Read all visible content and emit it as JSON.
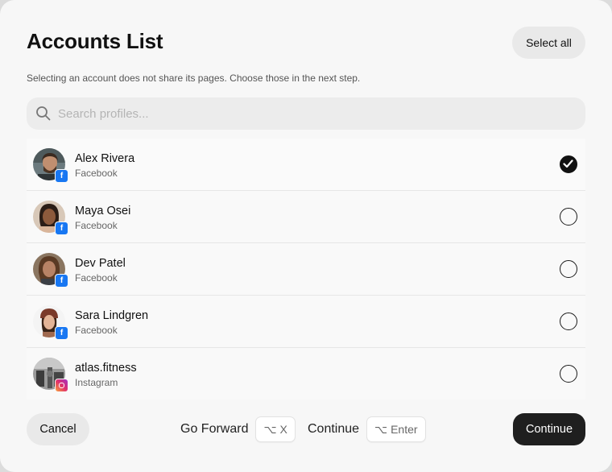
{
  "modal": {
    "title": "Accounts List",
    "select_all_label": "Select all",
    "subtitle": "Selecting an account does not share its pages. Choose those in the next step."
  },
  "search": {
    "placeholder": "Search profiles..."
  },
  "accounts": [
    {
      "name": "Alex Rivera",
      "platform": "Facebook",
      "selected": true
    },
    {
      "name": "Maya Osei",
      "platform": "Facebook",
      "selected": false
    },
    {
      "name": "Dev Patel",
      "platform": "Facebook",
      "selected": false
    },
    {
      "name": "Sara Lindgren",
      "platform": "Facebook",
      "selected": false
    },
    {
      "name": "atlas.fitness",
      "platform": "Instagram",
      "selected": false
    }
  ],
  "footer": {
    "cancel_label": "Cancel",
    "go_forward_label": "Go Forward",
    "go_forward_shortcut": "⌥ X",
    "continue_hint_label": "Continue",
    "continue_shortcut": "⌥ Enter",
    "continue_button_label": "Continue"
  },
  "colors": {
    "facebook_badge": "#1877f2",
    "primary_button": "#1f1f1f"
  }
}
